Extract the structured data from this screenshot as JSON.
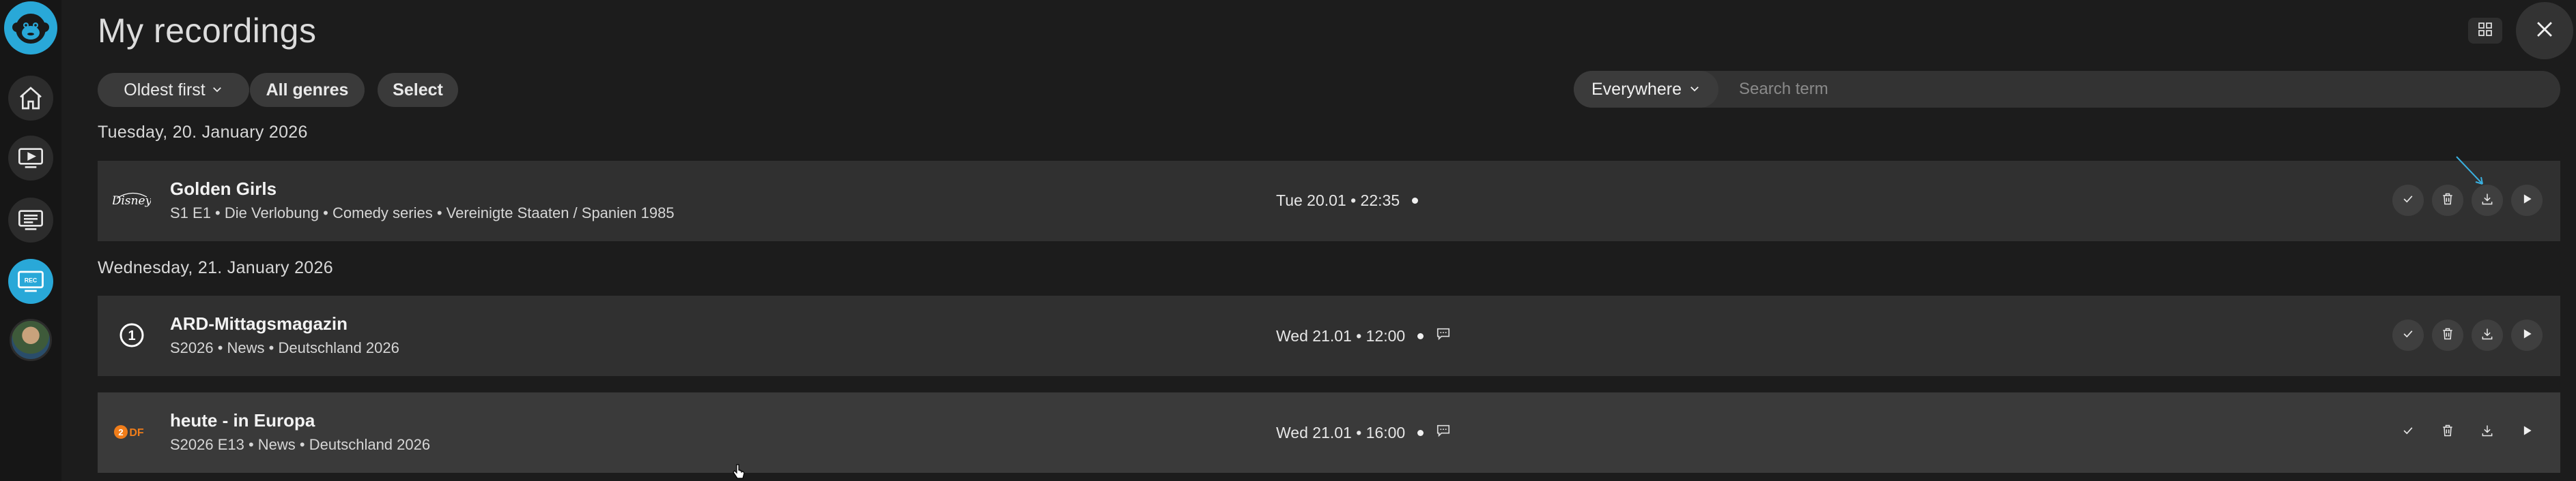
{
  "sidebar": {
    "icons": [
      "monkey-logo-icon",
      "home-icon",
      "tv-play-icon",
      "guide-icon",
      "recordings-icon",
      "avatar"
    ]
  },
  "header": {
    "title": "My recordings",
    "grid_icon": "grid-icon",
    "close_icon": "close-icon"
  },
  "filters": {
    "sort_label": "Oldest first",
    "genre_label": "All genres",
    "select_label": "Select"
  },
  "search": {
    "scope_label": "Everywhere",
    "placeholder": "Search term",
    "value": ""
  },
  "groups": [
    {
      "date": "Tuesday, 20. January 2026",
      "items": [
        {
          "channel": "Disney",
          "title": "Golden Girls",
          "meta": "S1 E1 • Die Verlobung • Comedy series • Vereinigte Staaten / Spanien 1985",
          "when": "Tue 20.01 • 22:35",
          "subtitles": false
        }
      ]
    },
    {
      "date": "Wednesday, 21. January 2026",
      "items": [
        {
          "channel": "ARD",
          "title": "ARD-Mittagsmagazin",
          "meta": "S2026 • News • Deutschland 2026",
          "when": "Wed 21.01 • 12:00",
          "subtitles": true
        },
        {
          "channel": "ZDF",
          "title": "heute - in Europa",
          "meta": "S2026 E13 • News • Deutschland 2026",
          "when": "Wed 21.01 • 16:00",
          "subtitles": true
        }
      ]
    }
  ],
  "colors": {
    "accent": "#29a8d8",
    "background": "#1c1c1c",
    "row": "#303030",
    "zdf_orange": "#f07d1a"
  }
}
